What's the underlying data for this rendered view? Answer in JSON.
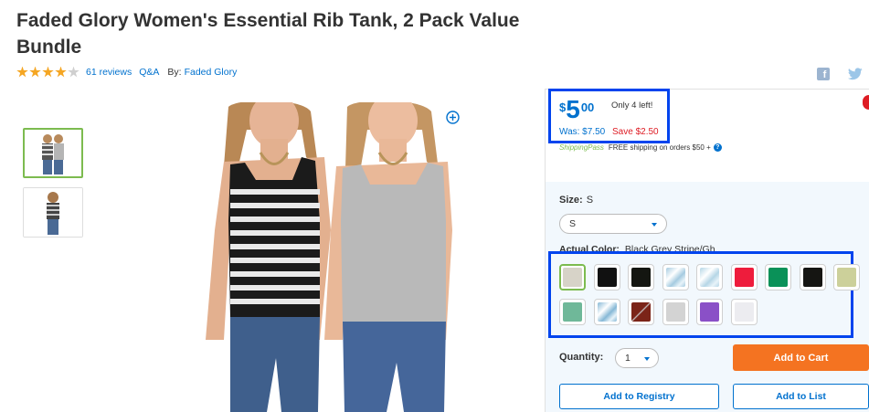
{
  "product": {
    "title": "Faded Glory Women's Essential Rib Tank, 2 Pack Value Bundle",
    "rating": 4,
    "rating_max": 5,
    "reviews": "61 reviews",
    "qa": "Q&A",
    "by_label": "By:",
    "brand": "Faded Glory"
  },
  "price": {
    "currency": "$",
    "dollars": "5",
    "cents": "00",
    "stock_note": "Only 4 left!",
    "was": "Was: $7.50",
    "save": "Save $2.50"
  },
  "shipping": {
    "pass": "ShippingPass",
    "free_text": "FREE shipping on orders $50 +",
    "info": "?"
  },
  "size": {
    "label": "Size:",
    "current": "S",
    "selected": "S"
  },
  "color": {
    "label": "Actual Color:",
    "current": "Black Grey Stripe/Gh..",
    "swatches": [
      {
        "name": "heather-gray",
        "color": "#d7d3c8",
        "selected": true
      },
      {
        "name": "black",
        "color": "#111111"
      },
      {
        "name": "black-2",
        "color": "#141611"
      },
      {
        "name": "blue-marble",
        "color": "#a5cbe0"
      },
      {
        "name": "blue-marble-2",
        "color": "#b5d6e6"
      },
      {
        "name": "red",
        "color": "#ee1c3c"
      },
      {
        "name": "green",
        "color": "#0a9158"
      },
      {
        "name": "black-3",
        "color": "#151512"
      },
      {
        "name": "sage",
        "color": "#ccd09a"
      },
      {
        "name": "mint",
        "color": "#6fb899"
      },
      {
        "name": "blue-marble-3",
        "color": "#86b8d6"
      },
      {
        "name": "burgundy",
        "color": "#7b2418"
      },
      {
        "name": "light-gray",
        "color": "#d3d3d3"
      },
      {
        "name": "purple",
        "color": "#8a50c7"
      },
      {
        "name": "white",
        "color": "#ececf0"
      }
    ]
  },
  "quantity": {
    "label": "Quantity:",
    "value": "1"
  },
  "actions": {
    "add_to_cart": "Add to Cart",
    "add_to_registry": "Add to Registry",
    "add_to_list": "Add to List"
  },
  "colors": {
    "walmart_blue": "#0071ce",
    "cart_orange": "#f47321",
    "save_red": "#de1c24",
    "highlight_blue": "#0044ee",
    "star_yellow": "#f5a623",
    "selected_green": "#7cbb4f"
  }
}
